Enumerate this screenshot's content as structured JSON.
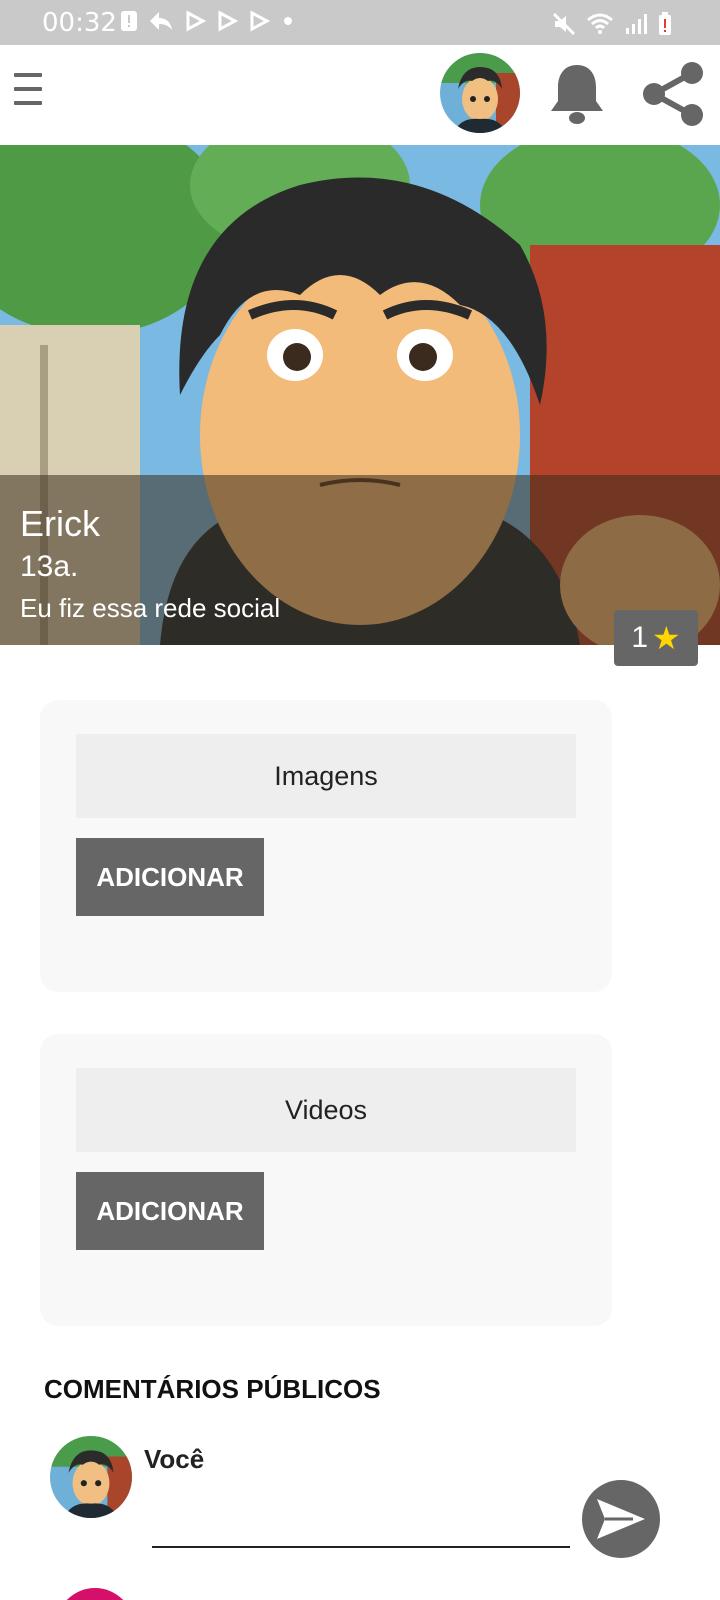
{
  "status_bar": {
    "time": "00:32",
    "left_icons": [
      "alert-icon",
      "reply-icon",
      "play-outline-icon",
      "play-outline-icon",
      "play-outline-icon",
      "dot-icon"
    ],
    "right_icons": [
      "mute-icon",
      "wifi-icon",
      "signal-icon",
      "battery-alert-icon"
    ]
  },
  "app_bar": {
    "menu_icon": "menu-icon",
    "notification_icon": "bell-icon",
    "share_icon": "share-icon"
  },
  "profile": {
    "name": "Erick",
    "age": "13a.",
    "bio": "Eu fiz essa rede social",
    "rating": "1",
    "rating_icon": "★"
  },
  "sections": [
    {
      "title": "Imagens",
      "button_label": "ADICIONAR"
    },
    {
      "title": "Videos",
      "button_label": "ADICIONAR"
    }
  ],
  "comments": {
    "title": "COMENTÁRIOS PÚBLICOS",
    "current_user": "Você",
    "input_placeholder": ""
  },
  "colors": {
    "status_bar": "#c9c9c9",
    "button": "#666666",
    "card_bg": "#f8f8f8",
    "card_header": "#eeeeee",
    "star": "#ffd600"
  }
}
